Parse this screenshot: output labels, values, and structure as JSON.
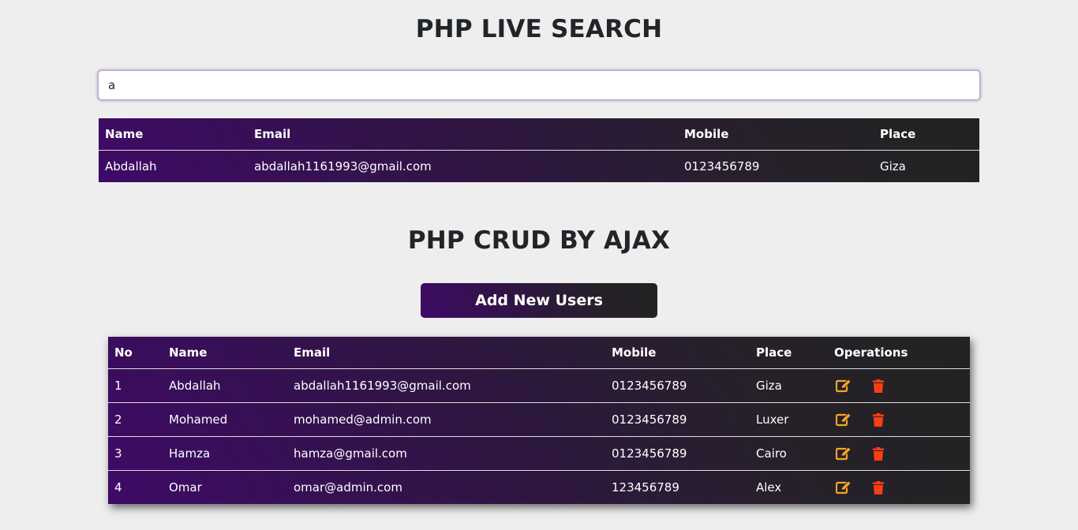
{
  "search_section": {
    "title": "PHP LIVE SEARCH",
    "search_value": "a",
    "columns": [
      "Name",
      "Email",
      "Mobile",
      "Place"
    ],
    "results": [
      {
        "name": "Abdallah",
        "email": "abdallah1161993@gmail.com",
        "mobile": "0123456789",
        "place": "Giza"
      }
    ]
  },
  "crud_section": {
    "title": "PHP CRUD BY AJAX",
    "add_button_label": "Add New Users",
    "columns": [
      "No",
      "Name",
      "Email",
      "Mobile",
      "Place",
      "Operations"
    ],
    "rows": [
      {
        "no": "1",
        "name": "Abdallah",
        "email": "abdallah1161993@gmail.com",
        "mobile": "0123456789",
        "place": "Giza"
      },
      {
        "no": "2",
        "name": "Mohamed",
        "email": "mohamed@admin.com",
        "mobile": "0123456789",
        "place": "Luxer"
      },
      {
        "no": "3",
        "name": "Hamza",
        "email": "hamza@gmail.com",
        "mobile": "0123456789",
        "place": "Cairo"
      },
      {
        "no": "4",
        "name": "Omar",
        "email": "omar@admin.com",
        "mobile": "123456789",
        "place": "Alex"
      }
    ],
    "operation_icons": {
      "edit": "edit-icon",
      "delete": "trash-icon"
    }
  },
  "colors": {
    "page_bg": "#eeeeee",
    "gradient_start": "#3e0a66",
    "gradient_end": "#222222",
    "edit_icon": "#f5a623",
    "delete_icon": "#ff3d12"
  }
}
